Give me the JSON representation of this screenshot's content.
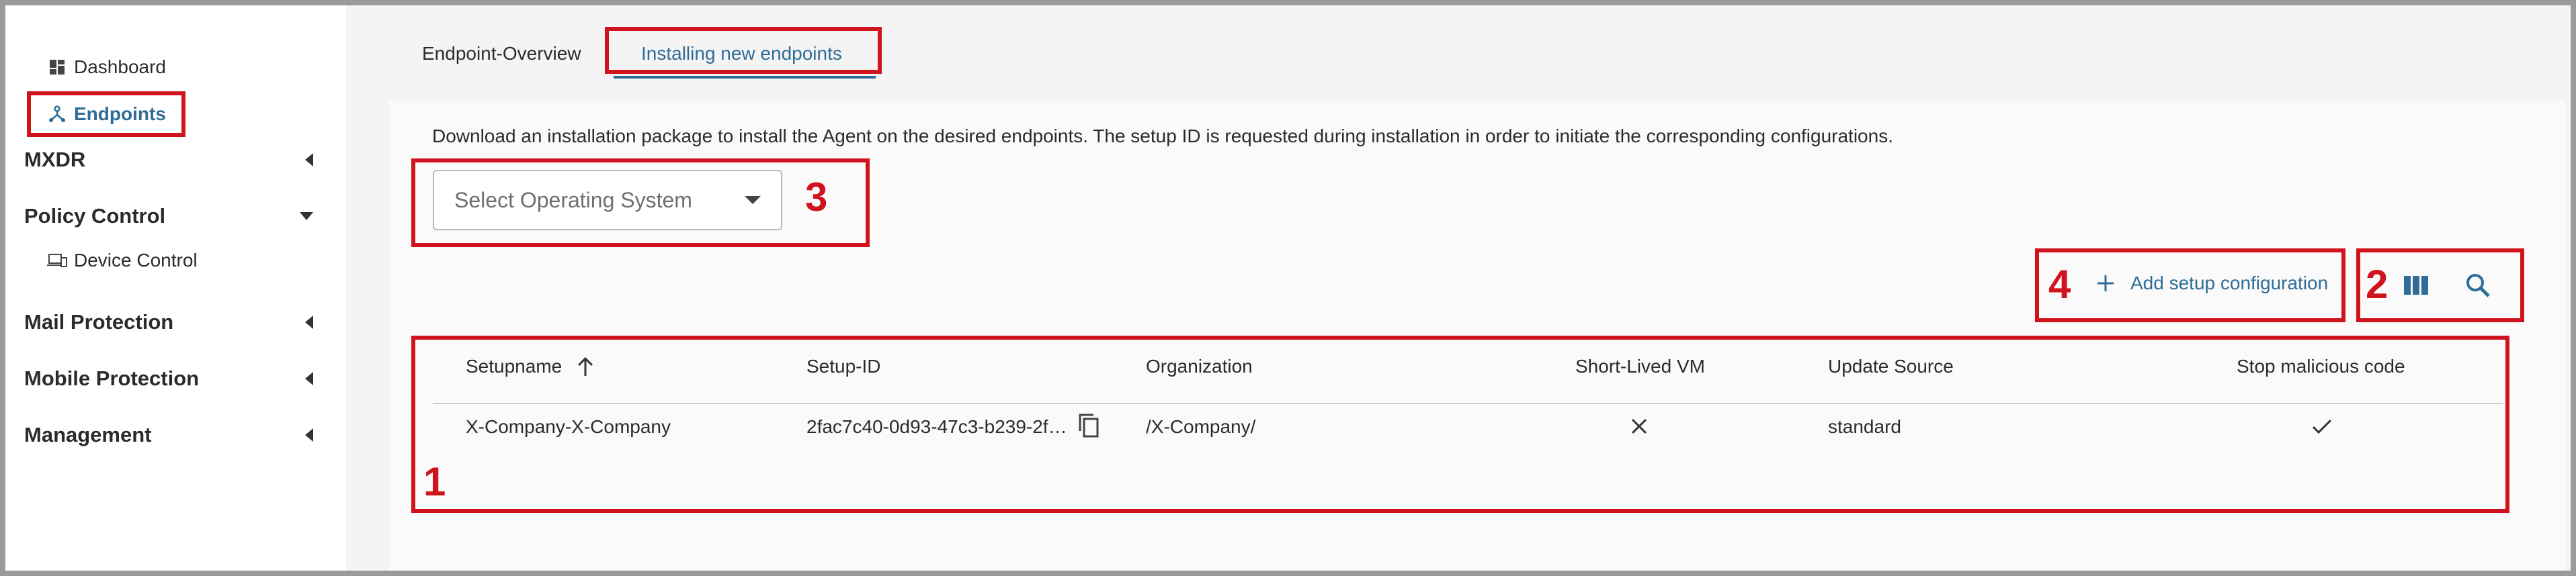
{
  "sidebar": {
    "items": [
      {
        "label": "Dashboard",
        "icon": "dashboard-icon"
      },
      {
        "label": "Endpoints",
        "icon": "endpoints-icon",
        "active": true
      }
    ],
    "sections": [
      {
        "label": "MXDR",
        "expanded": false
      },
      {
        "label": "Policy Control",
        "expanded": true,
        "children": [
          {
            "label": "Device Control",
            "icon": "device-icon"
          }
        ]
      },
      {
        "label": "Mail Protection",
        "expanded": false
      },
      {
        "label": "Mobile Protection",
        "expanded": false
      },
      {
        "label": "Management",
        "expanded": false
      }
    ]
  },
  "tabs": [
    {
      "label": "Endpoint-Overview",
      "active": false
    },
    {
      "label": "Installing new endpoints",
      "active": true
    }
  ],
  "main": {
    "description": "Download an installation package to install the Agent on the desired endpoints. The setup ID is requested during installation in order to initiate the corresponding configurations.",
    "os_select": {
      "placeholder": "Select Operating System"
    },
    "add_button": "Add setup configuration"
  },
  "table": {
    "columns": [
      "Setupname",
      "Setup-ID",
      "Organization",
      "Short-Lived VM",
      "Update Source",
      "Stop malicious code"
    ],
    "sort": {
      "column": "Setupname",
      "direction": "ascending"
    },
    "rows": [
      {
        "setupname": "X-Company-X-Company",
        "setup_id": "2fac7c40-0d93-47c3-b239-2f…",
        "organization": "/X-Company/",
        "short_lived_vm": false,
        "update_source": "standard",
        "stop_malicious_code": true
      }
    ]
  },
  "annotations": [
    "1",
    "2",
    "3",
    "4"
  ],
  "colors": {
    "accent": "#2f6c98",
    "highlight": "#d0141e"
  }
}
